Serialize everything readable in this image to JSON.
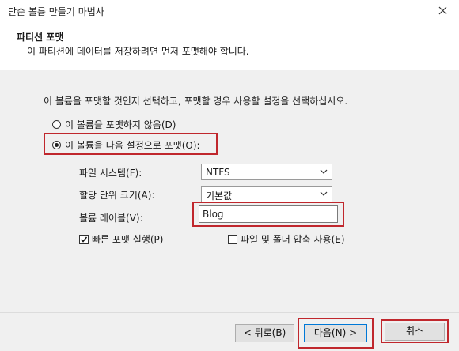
{
  "window": {
    "title": "단순 볼륨 만들기 마법사"
  },
  "header": {
    "title": "파티션 포맷",
    "subtitle": "이 파티션에 데이터를 저장하려면 먼저 포맷해야 합니다."
  },
  "content": {
    "instruction": "이 볼륨을 포맷할 것인지 선택하고, 포맷할 경우 사용할 설정을 선택하십시오.",
    "option_no_format": "이 볼륨을 포맷하지 않음(D)",
    "option_format": "이 볼륨을 다음 설정으로 포맷(O):",
    "selected_option": "option_format",
    "file_system_label": "파일 시스템(F):",
    "file_system_value": "NTFS",
    "allocation_label": "할당 단위 크기(A):",
    "allocation_value": "기본값",
    "volume_label_label": "볼륨 레이블(V):",
    "volume_label_value": "Blog",
    "quick_format_label": "빠른 포맷 실행(P)",
    "quick_format_checked": true,
    "compression_label": "파일 및 폴더 압축 사용(E)",
    "compression_checked": false
  },
  "footer": {
    "back_label": "< 뒤로(B)",
    "next_label": "다음(N) >",
    "cancel_label": "취소"
  },
  "colors": {
    "highlight": "#c0272d",
    "accent": "#0078d7"
  }
}
